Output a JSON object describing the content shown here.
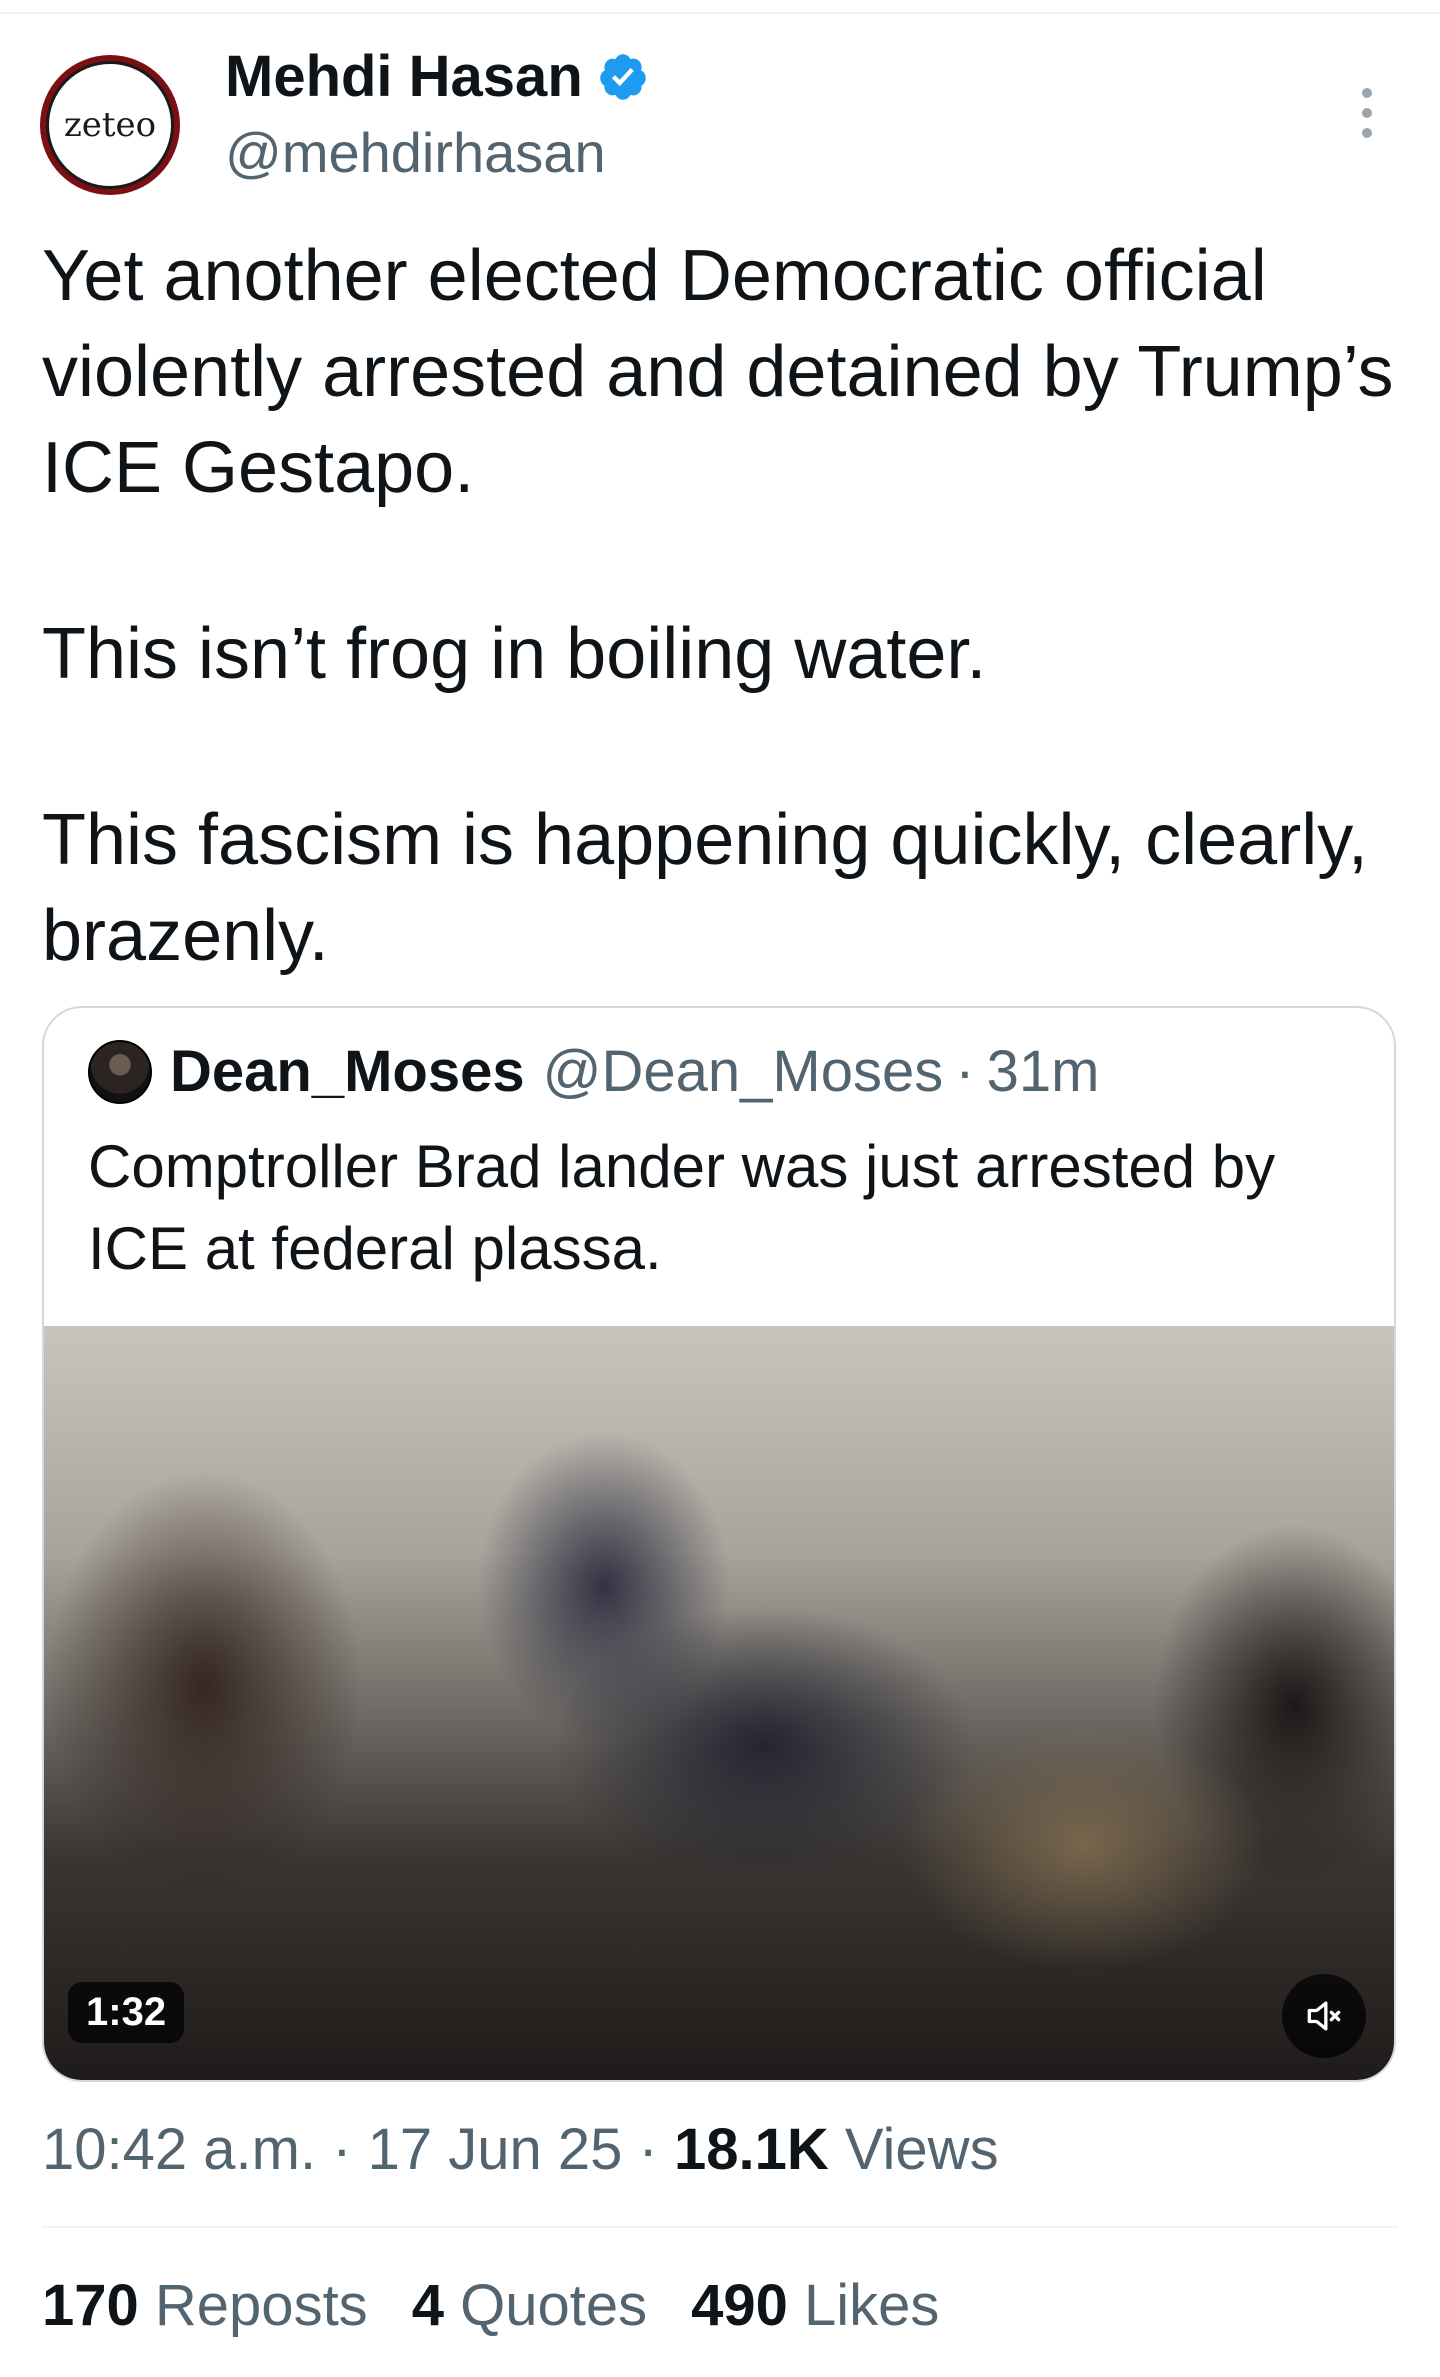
{
  "author": {
    "avatar_text": "zeteo",
    "display_name": "Mehdi Hasan",
    "handle": "@mehdirhasan"
  },
  "tweet": {
    "paragraphs": [
      "Yet another elected Democratic official violently arrested and detained by Trump’s ICE Gestapo.",
      "This isn’t frog in boiling water.",
      "This fascism is happening quickly, clearly, brazenly."
    ]
  },
  "quoted_tweet": {
    "display_name": "Dean_Moses",
    "handle": "@Dean_Moses",
    "separator": "·",
    "time": "31m",
    "text": "Comptroller Brad lander was just arrested by ICE at federal plassa.",
    "video_duration": "1:32"
  },
  "meta": {
    "time": "10:42 a.m.",
    "separator": "·",
    "date": "17 Jun 25",
    "views_count": "18.1K",
    "views_label": "Views"
  },
  "stats": {
    "reposts_count": "170",
    "reposts_label": "Reposts",
    "quotes_count": "4",
    "quotes_label": "Quotes",
    "likes_count": "490",
    "likes_label": "Likes"
  },
  "colors": {
    "verified": "#1d9bf0",
    "secondary_text": "#536471",
    "primary_text": "#0f1419",
    "avatar_ring": "#7a0f14"
  }
}
